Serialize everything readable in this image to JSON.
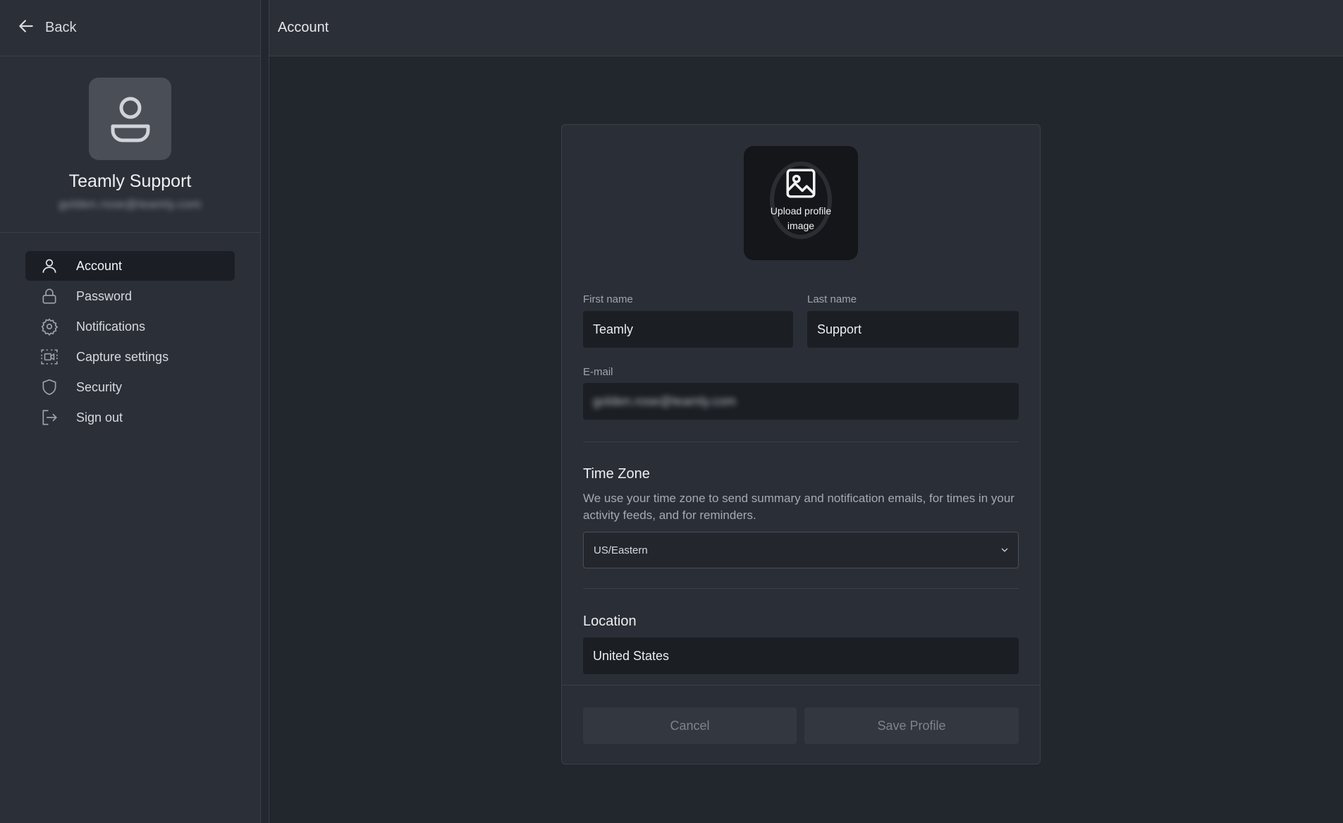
{
  "sidebar": {
    "back_label": "Back",
    "profile": {
      "name": "Teamly Support",
      "email": "golden.rose@teamly.com"
    },
    "items": [
      {
        "label": "Account",
        "icon": "user-icon",
        "active": true
      },
      {
        "label": "Password",
        "icon": "lock-icon"
      },
      {
        "label": "Notifications",
        "icon": "gear-icon"
      },
      {
        "label": "Capture settings",
        "icon": "video-capture-icon"
      },
      {
        "label": "Security",
        "icon": "shield-icon"
      },
      {
        "label": "Sign out",
        "icon": "sign-out-icon"
      }
    ]
  },
  "header": {
    "title": "Account"
  },
  "form": {
    "upload_label": "Upload profile image",
    "first_name_label": "First name",
    "first_name_value": "Teamly",
    "last_name_label": "Last name",
    "last_name_value": "Support",
    "email_label": "E-mail",
    "email_value": "golden.rose@teamly.com",
    "timezone": {
      "title": "Time Zone",
      "description": "We use your time zone to send summary and notification emails, for times in your activity feeds, and for reminders.",
      "selected": "US/Eastern"
    },
    "location": {
      "title": "Location",
      "value": "United States"
    },
    "cancel_label": "Cancel",
    "save_label": "Save Profile"
  },
  "colors": {
    "annotation_arrow": "#3b82f6",
    "background": "#22262d",
    "sidebar": "#2b2f37"
  }
}
